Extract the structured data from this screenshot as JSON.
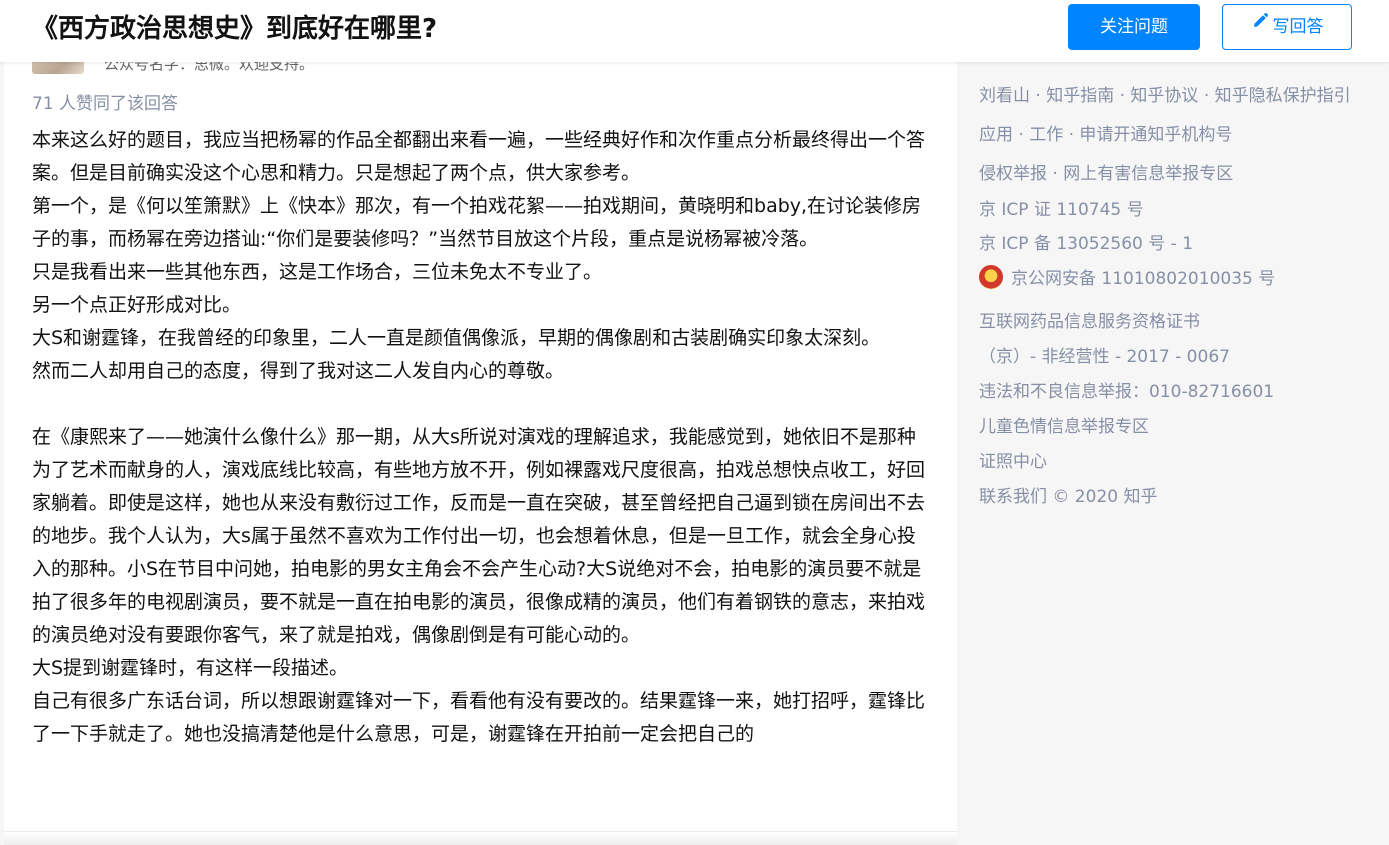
{
  "header": {
    "title": "《西方政治思想史》到底好在哪里?",
    "follow_label": "关注问题",
    "write_label": "写回答",
    "write_icon": "pencil-icon"
  },
  "answer": {
    "author_bio": "公众号名字：思微。欢迎支持。",
    "vote_count": "71 人赞同了该回答",
    "paragraphs": [
      "本来这么好的题目，我应当把杨幂的作品全都翻出来看一遍，一些经典好作和次作重点分析最终得出一个答案。但是目前确实没这个心思和精力。只是想起了两个点，供大家参考。",
      "第一个，是《何以笙箫默》上《快本》那次，有一个拍戏花絮——拍戏期间，黄晓明和baby,在讨论装修房子的事，而杨幂在旁边搭讪:“你们是要装修吗？”当然节目放这个片段，重点是说杨幂被冷落。",
      "只是我看出来一些其他东西，这是工作场合，三位未免太不专业了。",
      "另一个点正好形成对比。",
      "大S和谢霆锋，在我曾经的印象里，二人一直是颜值偶像派，早期的偶像剧和古装剧确实印象太深刻。",
      "然而二人却用自己的态度，得到了我对这二人发自内心的尊敬。",
      "",
      "在《康熙来了——她演什么像什么》那一期，从大s所说对演戏的理解追求，我能感觉到，她依旧不是那种为了艺术而献身的人，演戏底线比较高，有些地方放不开，例如裸露戏尺度很高，拍戏总想快点收工，好回家躺着。即使是这样，她也从来没有敷衍过工作，反而是一直在突破，甚至曾经把自己逼到锁在房间出不去的地步。我个人认为，大s属于虽然不喜欢为工作付出一切，也会想着休息，但是一旦工作，就会全身心投入的那种。小S在节目中问她，拍电影的男女主角会不会产生心动?大S说绝对不会，拍电影的演员要不就是拍了很多年的电视剧演员，要不就是一直在拍电影的演员，很像成精的演员，他们有着钢铁的意志，来拍戏的演员绝对没有要跟你客气，来了就是拍戏，偶像剧倒是有可能心动的。",
      "大S提到谢霆锋时，有这样一段描述。",
      "自己有很多广东话台词，所以想跟谢霆锋对一下，看看他有没有要改的。结果霆锋一来，她打招呼，霆锋比了一下手就走了。她也没搞清楚他是什么意思，可是，谢霆锋在开拍前一定会把自己的"
    ]
  },
  "sidebar_footer": {
    "lines": [
      "刘看山 · 知乎指南 · 知乎协议 · 知乎隐私保护指引",
      "应用 · 工作 · 申请开通知乎机构号",
      "侵权举报 · 网上有害信息举报专区",
      "京 ICP 证 110745 号",
      "京 ICP 备 13052560 号 - 1",
      "京公网安备 11010802010035 号",
      "互联网药品信息服务资格证书",
      "（京）- 非经营性 - 2017 - 0067",
      "违法和不良信息举报：010-82716601",
      "儿童色情信息举报专区",
      "证照中心",
      "联系我们 © 2020 知乎"
    ],
    "police_icon": "police-badge-icon"
  },
  "colors": {
    "accent": "#0084ff",
    "muted": "#8590a6",
    "text": "#121212",
    "background": "#f6f6f6"
  }
}
